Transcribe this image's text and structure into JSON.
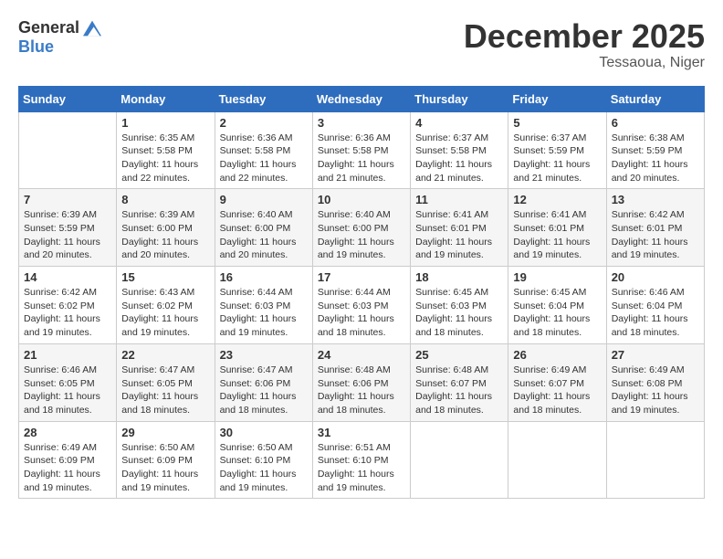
{
  "header": {
    "logo_general": "General",
    "logo_blue": "Blue",
    "month_title": "December 2025",
    "location": "Tessaoua, Niger"
  },
  "weekdays": [
    "Sunday",
    "Monday",
    "Tuesday",
    "Wednesday",
    "Thursday",
    "Friday",
    "Saturday"
  ],
  "weeks": [
    [
      {
        "day": "",
        "info": ""
      },
      {
        "day": "1",
        "info": "Sunrise: 6:35 AM\nSunset: 5:58 PM\nDaylight: 11 hours and 22 minutes."
      },
      {
        "day": "2",
        "info": "Sunrise: 6:36 AM\nSunset: 5:58 PM\nDaylight: 11 hours and 22 minutes."
      },
      {
        "day": "3",
        "info": "Sunrise: 6:36 AM\nSunset: 5:58 PM\nDaylight: 11 hours and 21 minutes."
      },
      {
        "day": "4",
        "info": "Sunrise: 6:37 AM\nSunset: 5:58 PM\nDaylight: 11 hours and 21 minutes."
      },
      {
        "day": "5",
        "info": "Sunrise: 6:37 AM\nSunset: 5:59 PM\nDaylight: 11 hours and 21 minutes."
      },
      {
        "day": "6",
        "info": "Sunrise: 6:38 AM\nSunset: 5:59 PM\nDaylight: 11 hours and 20 minutes."
      }
    ],
    [
      {
        "day": "7",
        "info": "Sunrise: 6:39 AM\nSunset: 5:59 PM\nDaylight: 11 hours and 20 minutes."
      },
      {
        "day": "8",
        "info": "Sunrise: 6:39 AM\nSunset: 6:00 PM\nDaylight: 11 hours and 20 minutes."
      },
      {
        "day": "9",
        "info": "Sunrise: 6:40 AM\nSunset: 6:00 PM\nDaylight: 11 hours and 20 minutes."
      },
      {
        "day": "10",
        "info": "Sunrise: 6:40 AM\nSunset: 6:00 PM\nDaylight: 11 hours and 19 minutes."
      },
      {
        "day": "11",
        "info": "Sunrise: 6:41 AM\nSunset: 6:01 PM\nDaylight: 11 hours and 19 minutes."
      },
      {
        "day": "12",
        "info": "Sunrise: 6:41 AM\nSunset: 6:01 PM\nDaylight: 11 hours and 19 minutes."
      },
      {
        "day": "13",
        "info": "Sunrise: 6:42 AM\nSunset: 6:01 PM\nDaylight: 11 hours and 19 minutes."
      }
    ],
    [
      {
        "day": "14",
        "info": "Sunrise: 6:42 AM\nSunset: 6:02 PM\nDaylight: 11 hours and 19 minutes."
      },
      {
        "day": "15",
        "info": "Sunrise: 6:43 AM\nSunset: 6:02 PM\nDaylight: 11 hours and 19 minutes."
      },
      {
        "day": "16",
        "info": "Sunrise: 6:44 AM\nSunset: 6:03 PM\nDaylight: 11 hours and 19 minutes."
      },
      {
        "day": "17",
        "info": "Sunrise: 6:44 AM\nSunset: 6:03 PM\nDaylight: 11 hours and 18 minutes."
      },
      {
        "day": "18",
        "info": "Sunrise: 6:45 AM\nSunset: 6:03 PM\nDaylight: 11 hours and 18 minutes."
      },
      {
        "day": "19",
        "info": "Sunrise: 6:45 AM\nSunset: 6:04 PM\nDaylight: 11 hours and 18 minutes."
      },
      {
        "day": "20",
        "info": "Sunrise: 6:46 AM\nSunset: 6:04 PM\nDaylight: 11 hours and 18 minutes."
      }
    ],
    [
      {
        "day": "21",
        "info": "Sunrise: 6:46 AM\nSunset: 6:05 PM\nDaylight: 11 hours and 18 minutes."
      },
      {
        "day": "22",
        "info": "Sunrise: 6:47 AM\nSunset: 6:05 PM\nDaylight: 11 hours and 18 minutes."
      },
      {
        "day": "23",
        "info": "Sunrise: 6:47 AM\nSunset: 6:06 PM\nDaylight: 11 hours and 18 minutes."
      },
      {
        "day": "24",
        "info": "Sunrise: 6:48 AM\nSunset: 6:06 PM\nDaylight: 11 hours and 18 minutes."
      },
      {
        "day": "25",
        "info": "Sunrise: 6:48 AM\nSunset: 6:07 PM\nDaylight: 11 hours and 18 minutes."
      },
      {
        "day": "26",
        "info": "Sunrise: 6:49 AM\nSunset: 6:07 PM\nDaylight: 11 hours and 18 minutes."
      },
      {
        "day": "27",
        "info": "Sunrise: 6:49 AM\nSunset: 6:08 PM\nDaylight: 11 hours and 19 minutes."
      }
    ],
    [
      {
        "day": "28",
        "info": "Sunrise: 6:49 AM\nSunset: 6:09 PM\nDaylight: 11 hours and 19 minutes."
      },
      {
        "day": "29",
        "info": "Sunrise: 6:50 AM\nSunset: 6:09 PM\nDaylight: 11 hours and 19 minutes."
      },
      {
        "day": "30",
        "info": "Sunrise: 6:50 AM\nSunset: 6:10 PM\nDaylight: 11 hours and 19 minutes."
      },
      {
        "day": "31",
        "info": "Sunrise: 6:51 AM\nSunset: 6:10 PM\nDaylight: 11 hours and 19 minutes."
      },
      {
        "day": "",
        "info": ""
      },
      {
        "day": "",
        "info": ""
      },
      {
        "day": "",
        "info": ""
      }
    ]
  ]
}
